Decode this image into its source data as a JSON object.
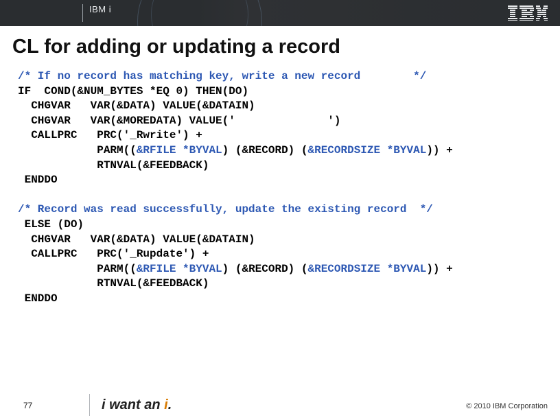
{
  "header": {
    "product_label_prefix": "IBM",
    "product_label_suffix": "i"
  },
  "title": "CL for adding or updating a record",
  "code": {
    "block1": {
      "comment": "/* If no record has matching key, write a new record        */",
      "line_if": "IF  COND(&NUM_BYTES *EQ 0) THEN(DO)",
      "line_chgvar1": "  CHGVAR   VAR(&DATA) VALUE(&DATAIN)",
      "line_chgvar2": "  CHGVAR   VAR(&MOREDATA) VALUE('              ')",
      "line_callprc": "  CALLPRC   PRC('_Rwrite') +",
      "line_parm_a": "            PARM((",
      "line_parm_rfile": "&RFILE *BYVAL",
      "line_parm_b": ") (&RECORD) (",
      "line_parm_recsize": "&RECORDSIZE *BYVAL",
      "line_parm_c": ")) +",
      "line_rtnval": "            RTNVAL(&FEEDBACK)",
      "line_enddo": " ENDDO"
    },
    "block2": {
      "comment": "/* Record was read successfully, update the existing record  */",
      "line_else": " ELSE (DO)",
      "line_chgvar1": "  CHGVAR   VAR(&DATA) VALUE(&DATAIN)",
      "line_callprc": "  CALLPRC   PRC('_Rupdate') +",
      "line_parm_a": "            PARM((",
      "line_parm_rfile": "&RFILE *BYVAL",
      "line_parm_b": ") (&RECORD) (",
      "line_parm_recsize": "&RECORDSIZE *BYVAL",
      "line_parm_c": ")) +",
      "line_rtnval": "            RTNVAL(&FEEDBACK)",
      "line_enddo": " ENDDO"
    }
  },
  "footer": {
    "page_number": "77",
    "tagline_prefix": "i want an ",
    "tagline_i": "i",
    "tagline_suffix": ".",
    "copyright": "© 2010 IBM Corporation"
  }
}
